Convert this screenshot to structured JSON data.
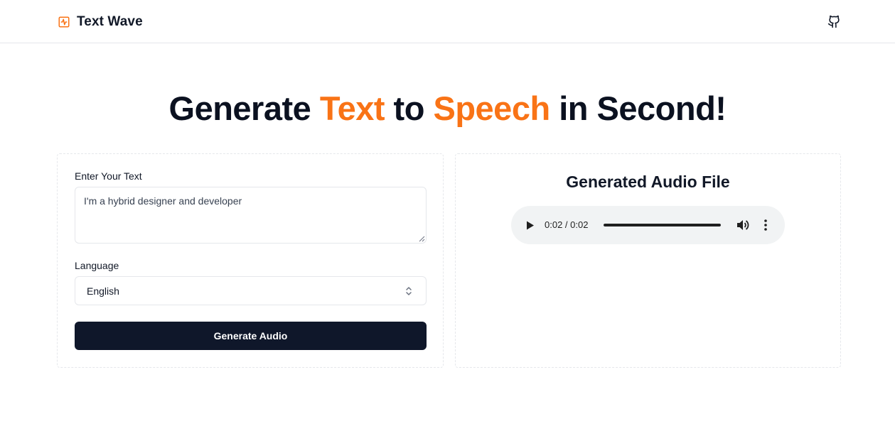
{
  "app": {
    "name": "Text Wave",
    "brand_icon": "activity-icon",
    "repo_icon": "github-icon",
    "accent_color": "#f97316",
    "button_color": "#0f172a"
  },
  "hero": {
    "part1": "Generate ",
    "highlight1": "Text",
    "part2": " to ",
    "highlight2": "Speech",
    "part3": " in Second!"
  },
  "form": {
    "text_label": "Enter Your Text",
    "text_value": "I'm a hybrid designer and developer",
    "language_label": "Language",
    "language_value": "English",
    "submit_label": "Generate Audio"
  },
  "output": {
    "title": "Generated Audio File",
    "player": {
      "current_time": "0:02",
      "separator": " / ",
      "duration": "0:02",
      "progress": 1.0,
      "play_icon": "play-icon",
      "volume_icon": "volume-icon",
      "menu_icon": "more-vertical-icon"
    }
  }
}
